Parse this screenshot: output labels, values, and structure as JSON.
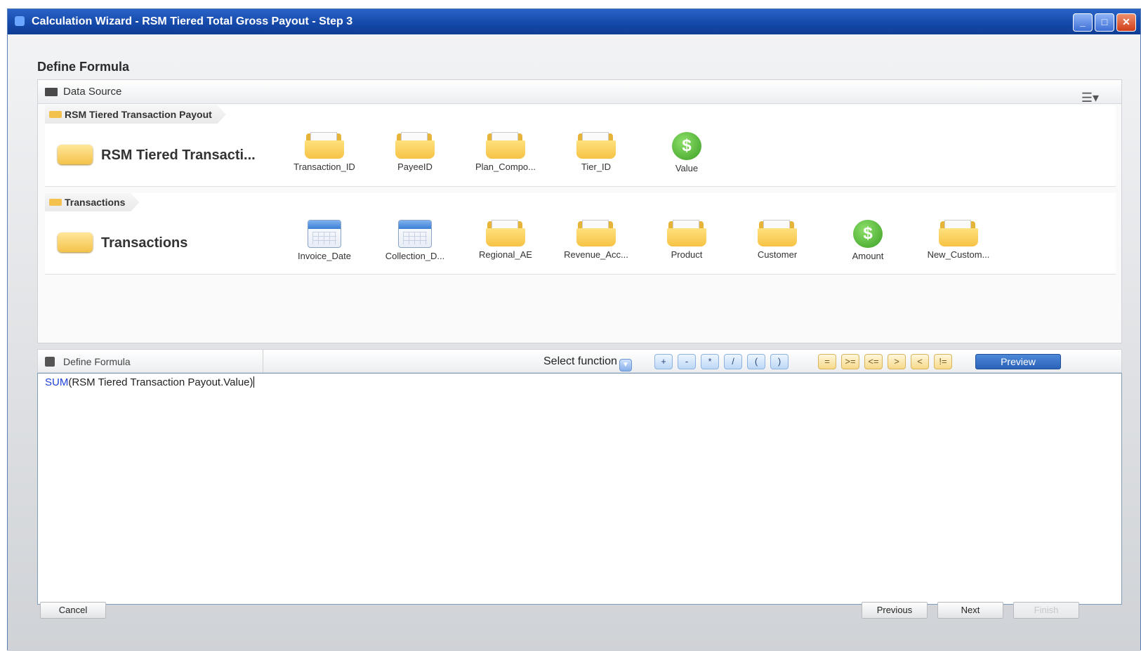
{
  "window": {
    "title": "Calculation Wizard - RSM Tiered Total Gross Payout - Step 3",
    "controls": [
      "_",
      "□",
      "✕"
    ]
  },
  "page": {
    "heading": "Define Formula"
  },
  "data_source": {
    "title": "Data Source",
    "groups": [
      {
        "tab": "RSM Tiered Transaction Payout",
        "name": "RSM Tiered Transacti...",
        "fields": [
          {
            "label": "Transaction_ID",
            "icon": "folder-icon"
          },
          {
            "label": "PayeeID",
            "icon": "folder-icon"
          },
          {
            "label": "Plan_Compo...",
            "icon": "folder-icon"
          },
          {
            "label": "Tier_ID",
            "icon": "folder-icon"
          },
          {
            "label": "Value",
            "icon": "dollar-icon"
          }
        ]
      },
      {
        "tab": "Transactions",
        "name": "Transactions",
        "fields": [
          {
            "label": "Invoice_Date",
            "icon": "calendar-icon"
          },
          {
            "label": "Collection_D...",
            "icon": "calendar-icon"
          },
          {
            "label": "Regional_AE",
            "icon": "folder-icon"
          },
          {
            "label": "Revenue_Acc...",
            "icon": "folder-icon"
          },
          {
            "label": "Product",
            "icon": "folder-icon"
          },
          {
            "label": "Customer",
            "icon": "folder-icon"
          },
          {
            "label": "Amount",
            "icon": "dollar-icon"
          },
          {
            "label": "New_Custom...",
            "icon": "folder-icon"
          }
        ]
      }
    ]
  },
  "formula": {
    "title": "Define Formula",
    "select_function": "Select function",
    "arith_ops": [
      "+",
      "-",
      "*",
      "/",
      "(",
      ")"
    ],
    "compare_ops": [
      "=",
      ">=",
      "<=",
      ">",
      "<",
      "!="
    ],
    "preview_label": "Preview",
    "expression_fn": "SUM",
    "expression_args": "(RSM Tiered Transaction Payout.Value)"
  },
  "footer": {
    "cancel": "Cancel",
    "previous": "Previous",
    "next": "Next",
    "finish": "Finish"
  },
  "colors": {
    "title_bar": "#1448a8",
    "accent": "#2a63b8",
    "function_text": "#1e3fd8"
  }
}
